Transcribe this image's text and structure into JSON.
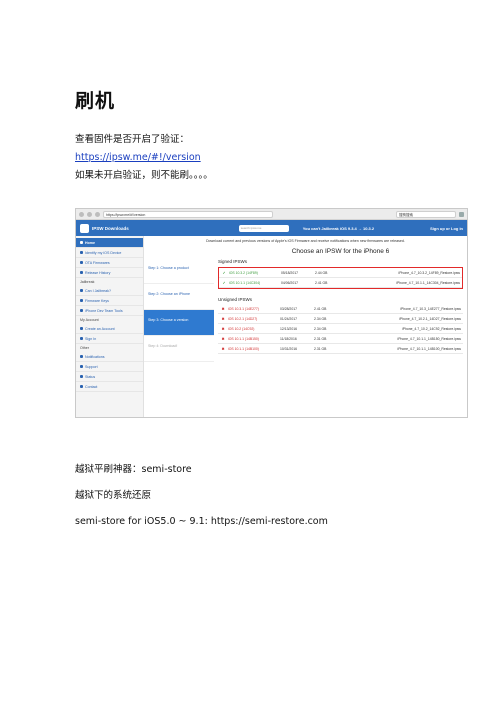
{
  "title": "刷机",
  "p1": "查看固件是否开启了验证：",
  "p2": "https://ipsw.me/#!/version",
  "p3": "如果未开启验证，则不能刷。。。。",
  "p4": "越狱平刷神器：semi-store",
  "p5": "越狱下的系统还原",
  "p6": "semi-store for iOS5.0 ~ 9.1: https://semi-restore.com",
  "screenshot": {
    "url": "https://ipsw.me/#!/version",
    "search_placeholder": "搜狗搜索",
    "brand": "IPSW Downloads",
    "site_search_placeholder": "search ipsw.me",
    "promo": "You can't Jailbreak iOS 9.3.4 → 10.3.2",
    "signin": "Sign up or Log in",
    "banner": "Download current and previous versions of Apple's iOS Firmware and receive notifications when new firmwares are released.",
    "sidebar": [
      "Home",
      "Identify my iOS Device",
      "OTA Firmwares",
      "Release History",
      "Jailbreak",
      "Can I Jailbreak?",
      "Firmware Keys",
      "iPhone Dev Team Tools",
      "My Account",
      "Create an Account",
      "Sign In",
      "Other",
      "Notifications",
      "Support",
      "Status",
      "Contact"
    ],
    "steps": [
      "Step 1: Choose a product",
      "Step 2: Choose an iPhone",
      "Step 3: Choose a version",
      "Step 4: Download!"
    ],
    "content_title": "Choose an IPSW for the iPhone 6",
    "signed_label": "Signed IPSWs",
    "unsigned_label": "Unsigned IPSWs",
    "signed": [
      {
        "ver": "iOS 10.3.2 (14F89)",
        "date": "05/18/2017",
        "size": "2.44 GB",
        "file": "iPhone_4.7_10.3.2_14F89_Restore.ipsw"
      },
      {
        "ver": "iOS 10.1.1 (14C304)",
        "date": "04/06/2017",
        "size": "2.41 GB",
        "file": "iPhone_4.7_10.1.1_14C304_Restore.ipsw"
      }
    ],
    "unsigned": [
      {
        "ver": "iOS 10.3.1 (14E277)",
        "date": "03/28/2017",
        "size": "2.41 GB",
        "file": "iPhone_4.7_10.3_14E277_Restore.ipsw"
      },
      {
        "ver": "iOS 10.2.1 (14D27)",
        "date": "01/24/2017",
        "size": "2.34 GB",
        "file": "iPhone_4.7_10.2.1_14D27_Restore.ipsw"
      },
      {
        "ver": "iOS 10.2 (14C92)",
        "date": "12/13/2016",
        "size": "2.34 GB",
        "file": "iPhone_4.7_10.2_14C92_Restore.ipsw"
      },
      {
        "ver": "iOS 10.1.1 (14B150)",
        "date": "11/18/2016",
        "size": "2.31 GB",
        "file": "iPhone_4.7_10.1.1_14B150_Restore.ipsw"
      },
      {
        "ver": "iOS 10.1.1 (14B100)",
        "date": "10/31/2016",
        "size": "2.31 GB",
        "file": "iPhone_4.7_10.1.1_14B100_Restore.ipsw"
      }
    ]
  }
}
